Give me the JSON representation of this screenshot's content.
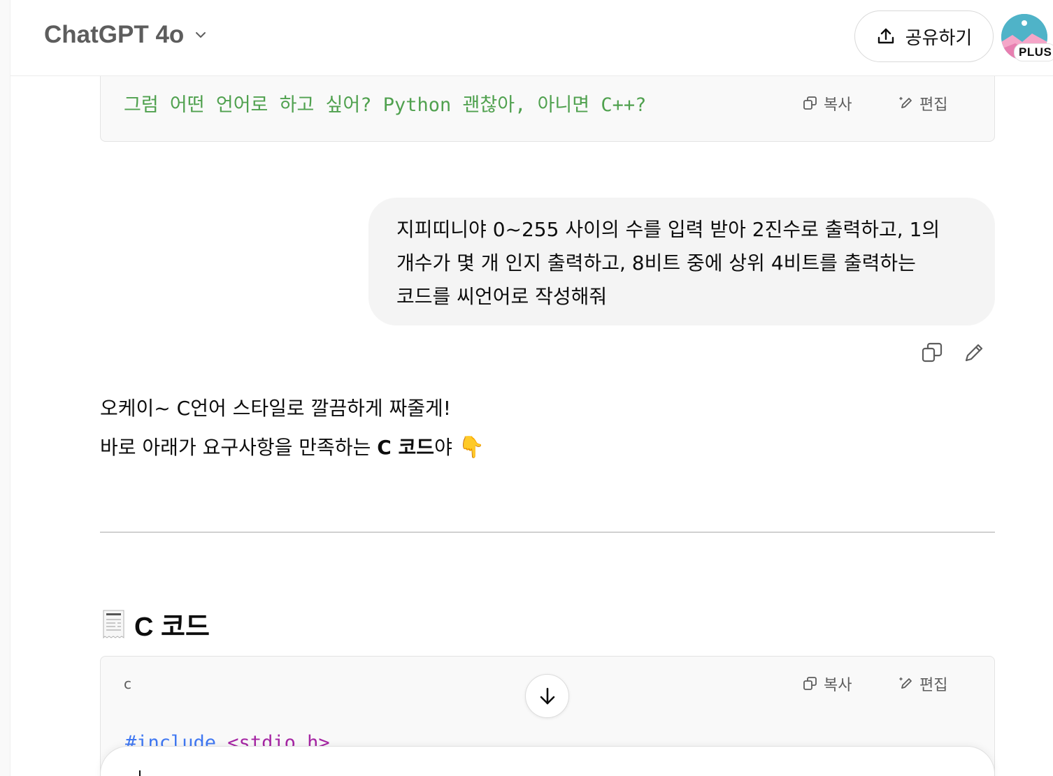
{
  "header": {
    "model_title": "ChatGPT 4o",
    "share_label": "공유하기",
    "plan_badge": "PLUS"
  },
  "top_code_block": {
    "line": "그럼 어떤 언어로 하고 싶어? Python 괜찮아, 아니면 C++?",
    "copy_label": "복사",
    "edit_label": "편집"
  },
  "user_message": {
    "lines": [
      "지피띠니야 0~255 사이의 수를 입력 받아 2진수로 출력하고, 1의",
      "개수가 몇 개 인지 출력하고, 8비트 중에 상위 4비트를 출력하는",
      "코드를 씨언어로 작성해줘"
    ]
  },
  "assistant_message": {
    "line1": "오케이~ C언어 스타일로 깔끔하게 짜줄게!",
    "line2_prefix": "바로 아래가 요구사항을 만족하는 ",
    "line2_bold": "C 코드",
    "line2_suffix": "야 ",
    "line2_emoji": "👇",
    "section_title": "C 코드",
    "section_icon": "receipt-icon"
  },
  "code_block": {
    "language": "c",
    "copy_label": "복사",
    "edit_label": "편집",
    "first_line_directive": "#include",
    "first_line_header": " <stdio.h>"
  },
  "colors": {
    "code_green": "#50a14f",
    "code_blue": "#4078f2",
    "code_purple": "#a626a4",
    "bubble_bg": "#f4f4f4",
    "code_bg": "#f9f9f9"
  }
}
